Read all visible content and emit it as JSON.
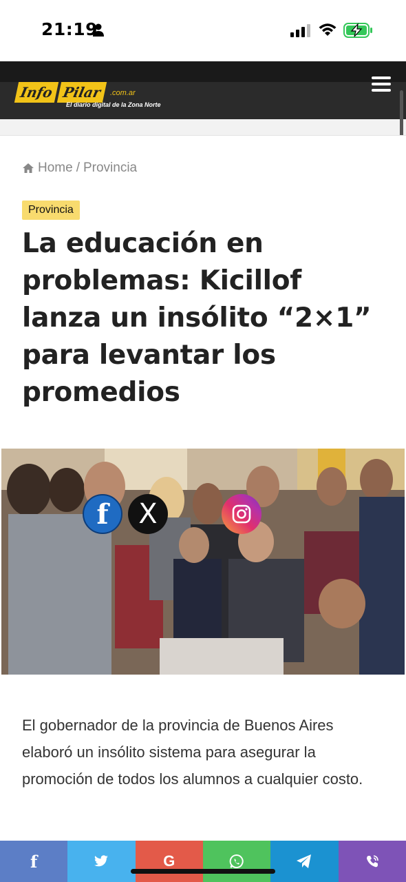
{
  "status_bar": {
    "time": "21:19",
    "icons": [
      "person-icon",
      "signal-icon",
      "wifi-icon",
      "battery-charging-icon"
    ],
    "battery_color": "#34c759"
  },
  "header": {
    "logo": {
      "word1": "Info",
      "word2": "Pilar",
      "domain": ".com.ar",
      "tagline": "El diario digital de la Zona Norte"
    },
    "menu_icon": "hamburger-menu-icon",
    "accent_color": "#f2c318"
  },
  "breadcrumb": {
    "home": "Home",
    "separator": "/",
    "current": "Provincia"
  },
  "article": {
    "category": "Provincia",
    "title": "La educación en problemas: Kicillof lanza un insólito “2×1” para levantar los promedios",
    "lead": "El gobernador de la provincia de Buenos Aires elaboró un insólito sistema para asegurar la promoción de todos los alumnos a cualquier costo."
  },
  "photo_share": {
    "facebook": "f",
    "x": "X"
  },
  "share_bar": [
    {
      "name": "facebook",
      "icon": "facebook-icon",
      "label": "f",
      "color": "#5c7ec6"
    },
    {
      "name": "twitter",
      "icon": "twitter-icon",
      "label": "",
      "color": "#48b2ee"
    },
    {
      "name": "google",
      "icon": "google-icon",
      "label": "G",
      "color": "#e35a49"
    },
    {
      "name": "whatsapp",
      "icon": "whatsapp-icon",
      "label": "",
      "color": "#4fc35d"
    },
    {
      "name": "telegram",
      "icon": "telegram-icon",
      "label": "",
      "color": "#1b92d1"
    },
    {
      "name": "viber",
      "icon": "viber-icon",
      "label": "",
      "color": "#7e53b7"
    }
  ]
}
